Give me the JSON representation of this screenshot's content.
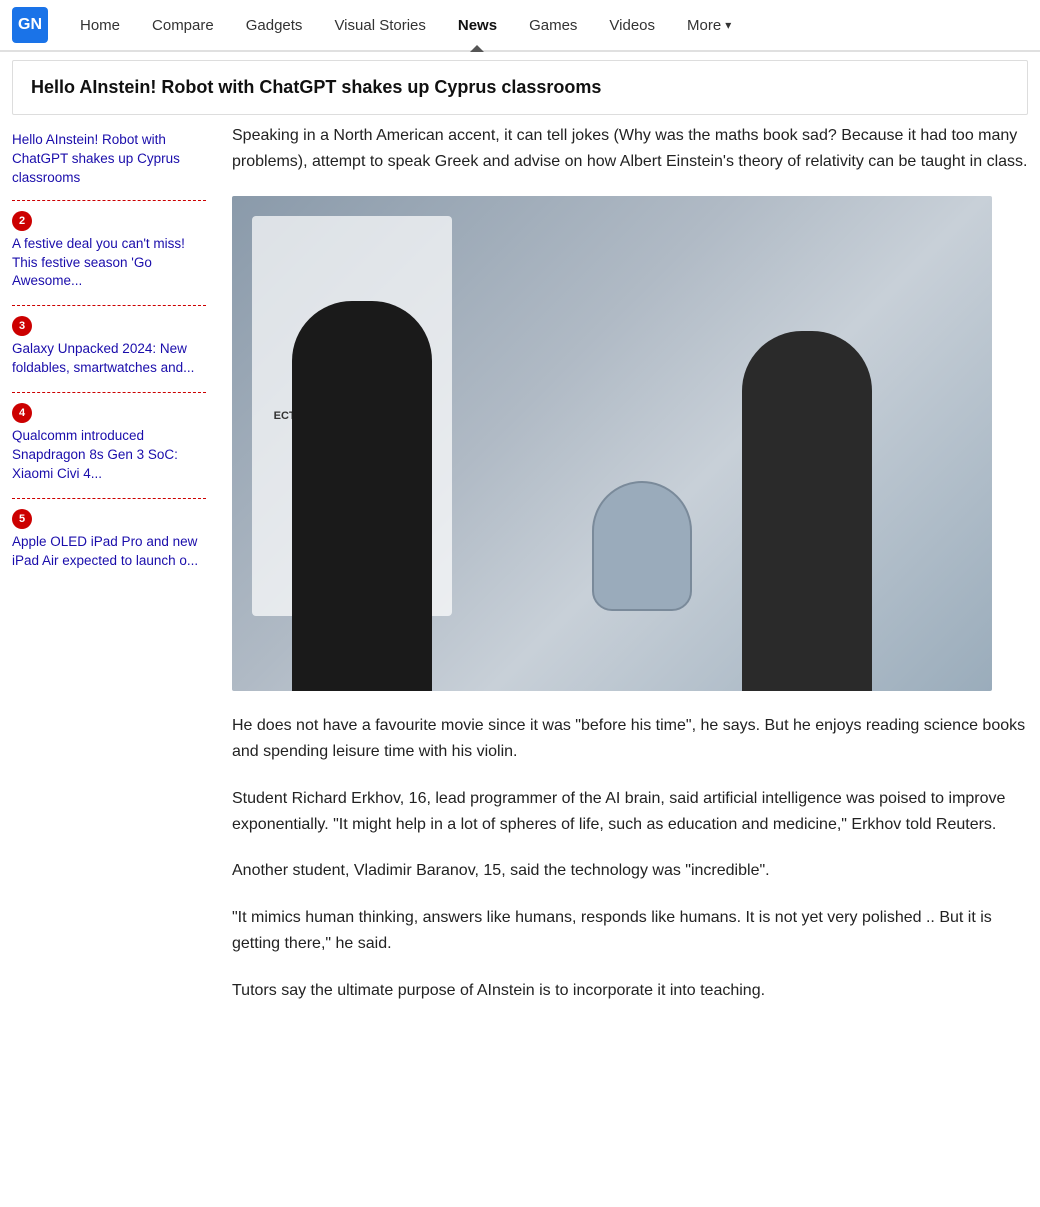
{
  "logo": {
    "text": "GN"
  },
  "nav": {
    "items": [
      {
        "label": "Home",
        "active": false
      },
      {
        "label": "Compare",
        "active": false
      },
      {
        "label": "Gadgets",
        "active": false
      },
      {
        "label": "Visual Stories",
        "active": false
      },
      {
        "label": "News",
        "active": true
      },
      {
        "label": "Games",
        "active": false
      },
      {
        "label": "Videos",
        "active": false
      },
      {
        "label": "More",
        "active": false,
        "hasChevron": true
      }
    ]
  },
  "article": {
    "title": "Hello AInstein! Robot with ChatGPT shakes up Cyprus classrooms",
    "para1": "Speaking in a North American accent, it can tell jokes (Why was the maths book sad? Because it had too many problems), attempt to speak Greek and advise on how Albert Einstein's theory of relativity can be taught in class.",
    "para2": "He does not have a favourite movie since it was \"before his time\", he says. But he enjoys reading science books and spending leisure time with his violin.",
    "para3": "Student Richard Erkhov, 16, lead programmer of the AI brain, said artificial intelligence was poised to improve exponentially. \"It might help in a lot of spheres of life, such as education and medicine,\" Erkhov told Reuters.",
    "para4": "Another student, Vladimir Baranov, 15, said the technology was \"incredible\".",
    "para5": "\"It mimics human thinking, answers like humans, responds like humans. It is not yet very polished .. But it is getting there,\" he said.",
    "para6": "Tutors say the ultimate purpose of AInstein is to incorporate it into teaching.",
    "image_alt": "Students interacting with AInstein robot in Cyprus classroom"
  },
  "sidebar": {
    "item1_title": "Hello AInstein! Robot with ChatGPT shakes up Cyprus classrooms",
    "items": [
      {
        "number": "2",
        "title": "A festive deal you can't miss! This festive season 'Go Awesome..."
      },
      {
        "number": "3",
        "title": "Galaxy Unpacked 2024: New foldables, smartwatches and..."
      },
      {
        "number": "4",
        "title": "Qualcomm introduced Snapdragon 8s Gen 3 SoC: Xiaomi Civi 4..."
      },
      {
        "number": "5",
        "title": "Apple OLED iPad Pro and new iPad Air expected to launch o..."
      }
    ]
  },
  "banner_text": "ECT AINSTEIN ROBOT BRAIN"
}
